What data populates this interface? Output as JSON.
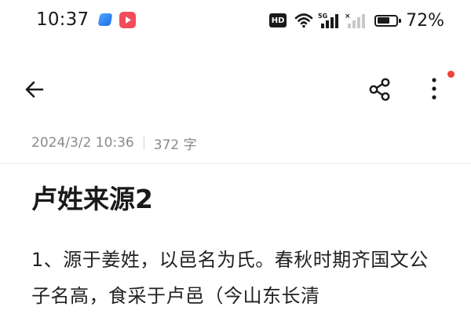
{
  "status_bar": {
    "time": "10:37",
    "hd_label": "HD",
    "network_label": "5G",
    "battery_percent": 72,
    "battery_text": "72%"
  },
  "note": {
    "date": "2024/3/2 10:36",
    "word_count": "372 字",
    "title": "卢姓来源2",
    "body": "1、源于姜姓，以邑名为氏。春秋时期齐国文公子名高，食采于卢邑（今山东长清"
  },
  "icons": {
    "back": "arrow-left-icon",
    "share": "share-icon",
    "more": "more-vertical-icon",
    "wifi": "wifi-icon",
    "signal": "signal-icon",
    "battery": "battery-icon"
  },
  "colors": {
    "text": "#1a1a1a",
    "meta_text": "#8a8a8a",
    "notification_dot": "#f2413b",
    "app_icon_red": "#f24b5a",
    "app_icon_blue": "#1f6fe8"
  }
}
